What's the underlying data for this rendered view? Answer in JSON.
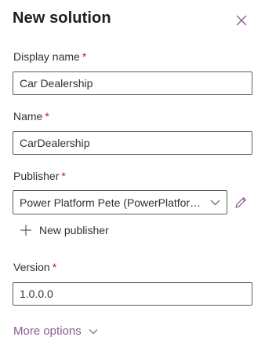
{
  "panel": {
    "title": "New solution",
    "close_icon": "close-icon"
  },
  "fields": {
    "display_name": {
      "label": "Display name",
      "required_mark": "*",
      "value": "Car Dealership"
    },
    "name": {
      "label": "Name",
      "required_mark": "*",
      "value": "CarDealership"
    },
    "publisher": {
      "label": "Publisher",
      "required_mark": "*",
      "selected": "Power Platform Pete (PowerPlatformPete)",
      "edit_icon": "pencil-icon",
      "chevron_icon": "chevron-down-icon"
    },
    "version": {
      "label": "Version",
      "required_mark": "*",
      "value": "1.0.0.0"
    }
  },
  "new_publisher": {
    "label": "New publisher",
    "icon": "plus-icon"
  },
  "more_options": {
    "label": "More options",
    "icon": "chevron-down-icon"
  },
  "colors": {
    "accent": "#8a5a91",
    "required": "#a4262c",
    "border": "#605e5c",
    "text": "#323130"
  }
}
